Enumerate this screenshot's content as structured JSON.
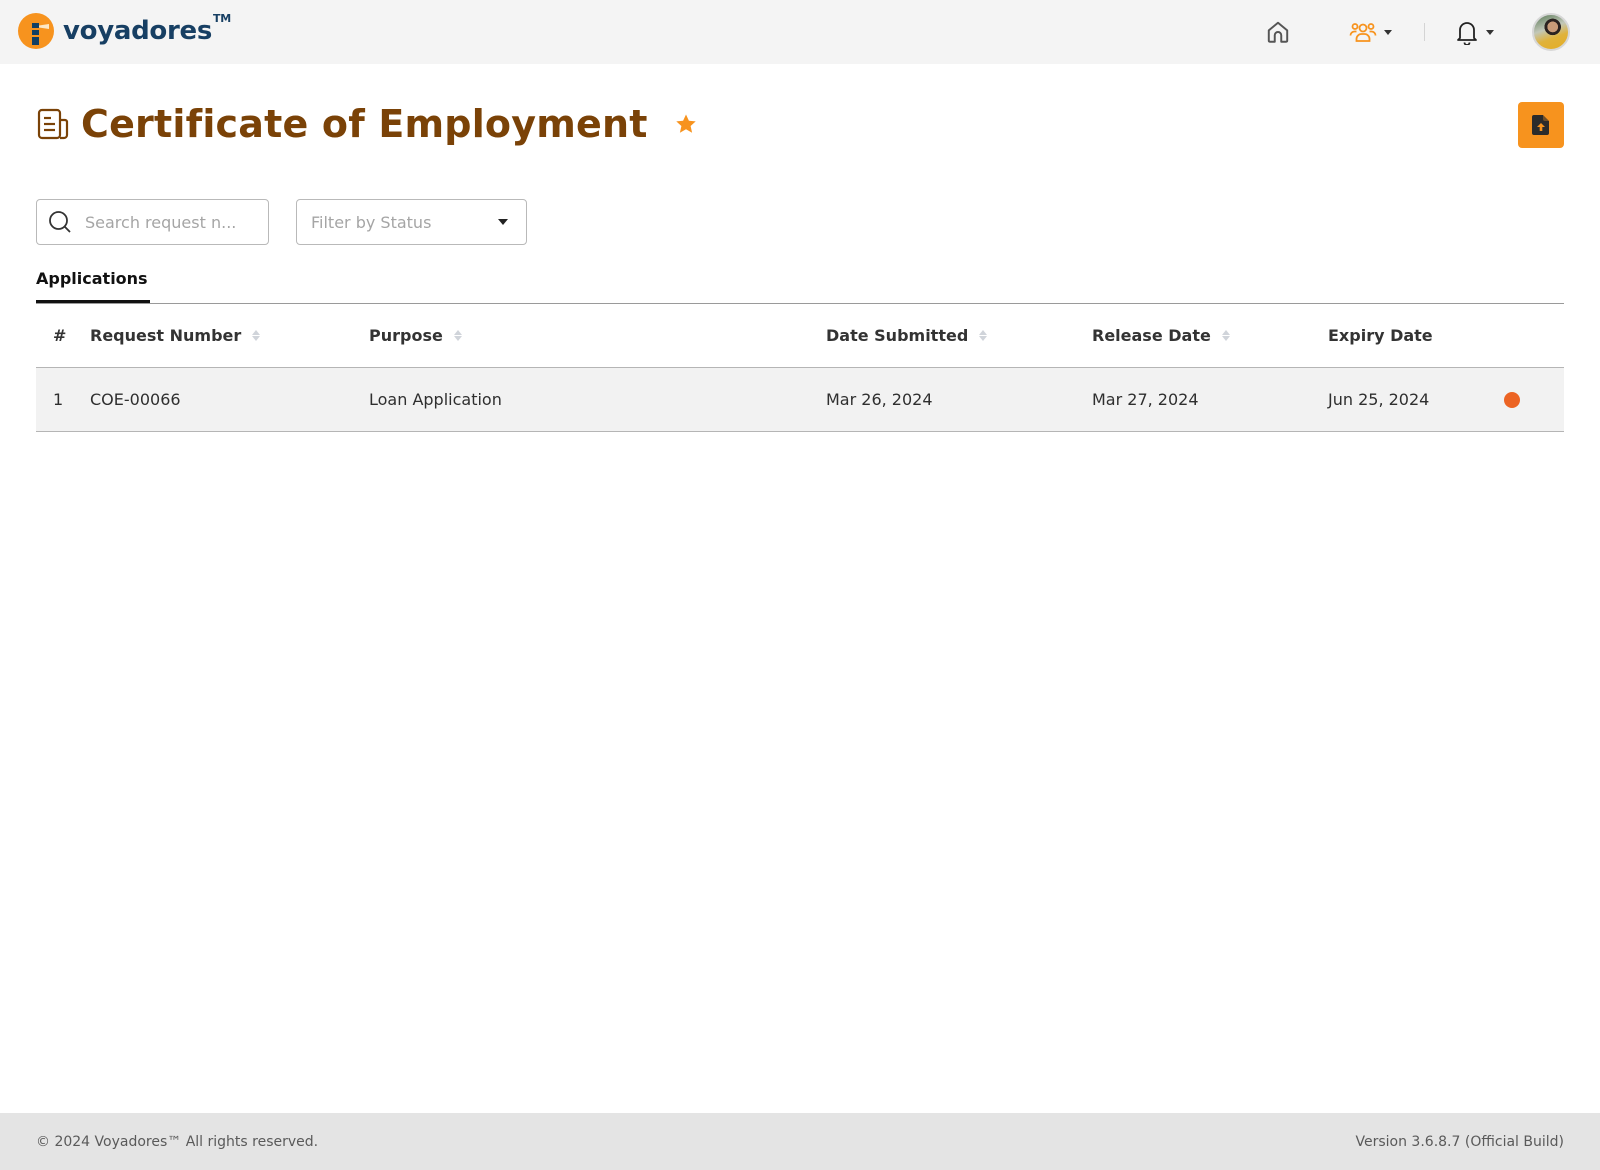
{
  "header": {
    "brand": "voyadores",
    "brand_tm": "TM",
    "nav": {
      "home_icon": "home-icon",
      "people_icon": "users-icon",
      "bell_icon": "bell-icon",
      "avatar": "user-avatar"
    },
    "colors": {
      "accent": "#f7931e",
      "brand_text": "#173f63"
    }
  },
  "page": {
    "title": "Certificate of Employment",
    "title_icon": "document-icon",
    "favorite_icon": "star-icon",
    "upload_button_icon": "file-upload-icon",
    "title_color": "#7a4207"
  },
  "filters": {
    "search_placeholder": "Search request n...",
    "search_value": "",
    "status_placeholder": "Filter by Status"
  },
  "tabs": [
    {
      "label": "Applications",
      "active": true
    }
  ],
  "table": {
    "columns": [
      {
        "label": "#",
        "sortable": false
      },
      {
        "label": "Request Number",
        "sortable": true
      },
      {
        "label": "Purpose",
        "sortable": true
      },
      {
        "label": "Date Submitted",
        "sortable": true
      },
      {
        "label": "Release Date",
        "sortable": true
      },
      {
        "label": "Expiry Date",
        "sortable": false
      }
    ],
    "rows": [
      {
        "index": "1",
        "request_number": "COE-00066",
        "purpose": "Loan Application",
        "date_submitted": "Mar 26, 2024",
        "release_date": "Mar 27, 2024",
        "expiry_date": "Jun 25, 2024",
        "status_color": "#ec6424"
      }
    ]
  },
  "footer": {
    "copyright": "© 2024 Voyadores™ All rights reserved.",
    "version": "Version 3.6.8.7 (Official Build)"
  }
}
